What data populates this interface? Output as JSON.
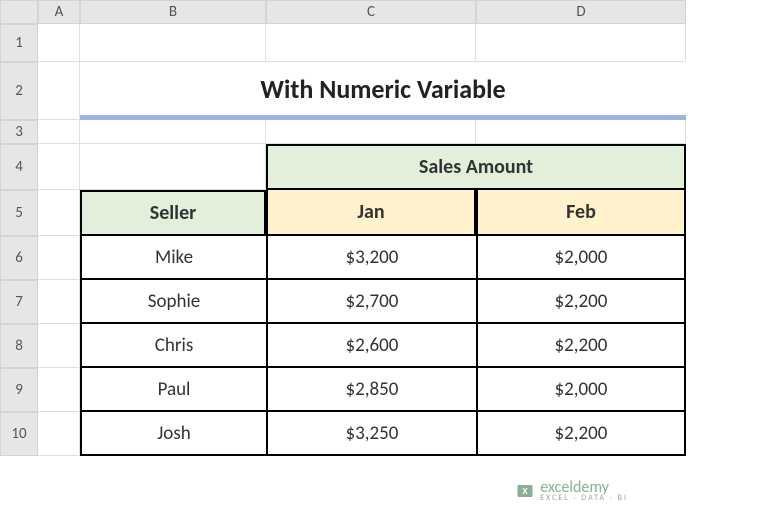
{
  "columns": [
    "A",
    "B",
    "C",
    "D"
  ],
  "rows": [
    "1",
    "2",
    "3",
    "4",
    "5",
    "6",
    "7",
    "8",
    "9",
    "10"
  ],
  "title": "With Numeric Variable",
  "table": {
    "salesHeader": "Sales Amount",
    "sellerHeader": "Seller",
    "months": [
      "Jan",
      "Feb"
    ],
    "data": [
      {
        "seller": "Mike",
        "jan": "$3,200",
        "feb": "$2,000"
      },
      {
        "seller": "Sophie",
        "jan": "$2,700",
        "feb": "$2,200"
      },
      {
        "seller": "Chris",
        "jan": "$2,600",
        "feb": "$2,200"
      },
      {
        "seller": "Paul",
        "jan": "$2,850",
        "feb": "$2,000"
      },
      {
        "seller": "Josh",
        "jan": "$3,250",
        "feb": "$2,200"
      }
    ]
  },
  "watermark": {
    "main": "exceldemy",
    "sub": "EXCEL · DATA · BI"
  }
}
